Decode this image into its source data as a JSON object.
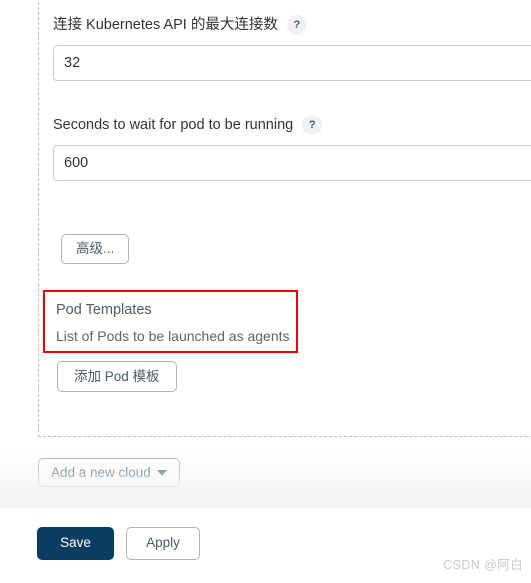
{
  "cloud_section": {
    "fields": [
      {
        "label": "连接 Kubernetes API 的最大连接数",
        "help": "?",
        "value": "32",
        "placeholder": ""
      },
      {
        "label": "Seconds to wait for pod to be running",
        "help": "?",
        "value": "600",
        "placeholder": ""
      }
    ],
    "advanced_button": "高级...",
    "pod_templates": {
      "heading": "Pod Templates",
      "description": "List of Pods to be launched as agents",
      "add_button": "添加 Pod 模板",
      "highlight_color": "#ee0000"
    }
  },
  "add_cloud": {
    "label": "Add a new cloud",
    "caret_icon": "chevron-down-icon"
  },
  "action_bar": {
    "save_label": "Save",
    "apply_label": "Apply",
    "save_color": "#0b3d63"
  },
  "watermark": {
    "text": "CSDN @阿白"
  }
}
